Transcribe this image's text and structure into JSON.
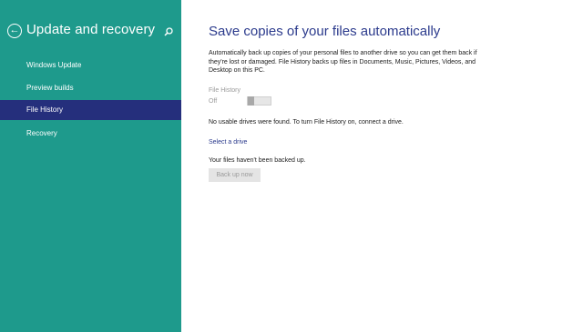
{
  "sidebar": {
    "title": "Update and recovery",
    "back_icon": "back-arrow-icon",
    "search_icon": "search-icon",
    "items": [
      {
        "label": "Windows Update",
        "selected": false
      },
      {
        "label": "Preview builds",
        "selected": false
      },
      {
        "label": "File History",
        "selected": true
      },
      {
        "label": "Recovery",
        "selected": false
      }
    ]
  },
  "main": {
    "title": "Save copies of your files automatically",
    "description": "Automatically back up copies of your personal files to another drive so you can get them back if they're lost or damaged. File History backs up files in Documents, Music, Pictures, Videos, and Desktop on this PC.",
    "toggle": {
      "label": "File History",
      "state": "Off",
      "enabled": false
    },
    "status_message": "No usable drives were found. To turn File History on, connect a drive.",
    "select_drive_label": "Select a drive",
    "backup_status": "Your files haven't been backed up.",
    "backup_button_label": "Back up now"
  },
  "colors": {
    "sidebar_bg": "#1e9a8c",
    "selected_bg": "#252f7c",
    "accent": "#2b3a8c"
  }
}
